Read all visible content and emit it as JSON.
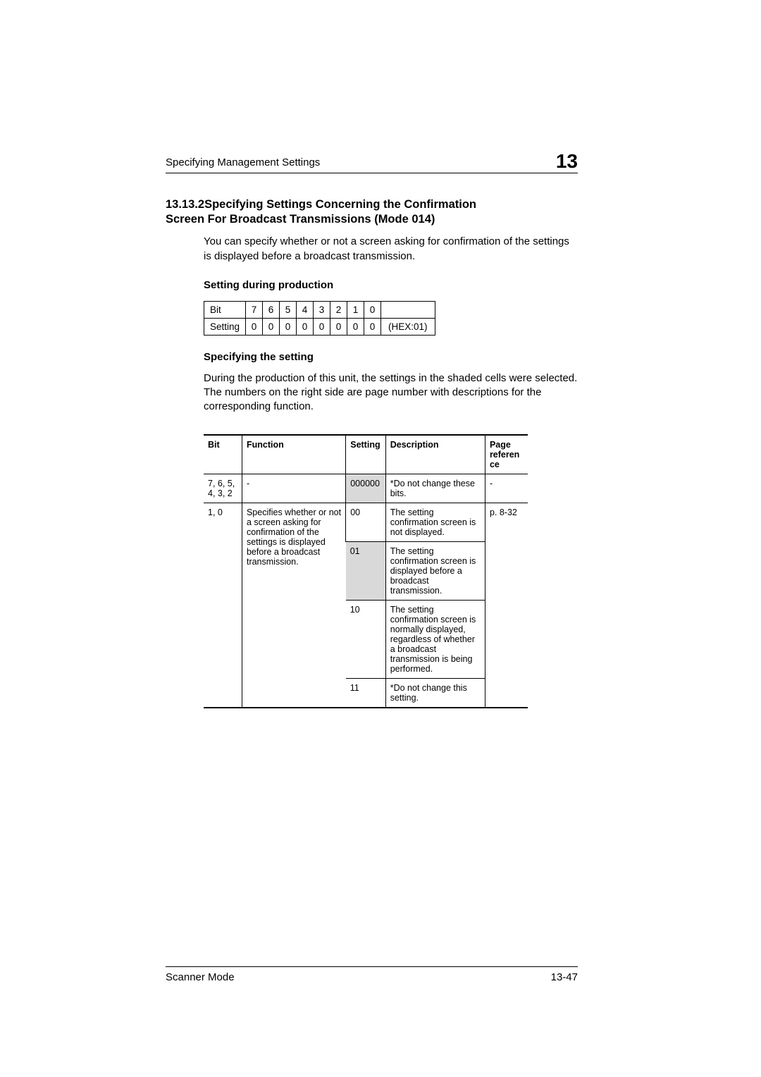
{
  "header": {
    "running_head": "Specifying Management Settings",
    "chapter_number": "13"
  },
  "section": {
    "number": "13.13.2",
    "title_line1": "Specifying Settings Concerning the Confirmation",
    "title_line2": "Screen For Broadcast Transmissions (Mode 014)"
  },
  "intro_text": "You can specify whether or not a screen asking for confirmation of the settings is displayed before a broadcast transmission.",
  "sub1": "Setting during production",
  "bit_table": {
    "rows": [
      {
        "label": "Bit",
        "c7": "7",
        "c6": "6",
        "c5": "5",
        "c4": "4",
        "c3": "3",
        "c2": "2",
        "c1": "1",
        "c0": "0",
        "hex": ""
      },
      {
        "label": "Setting",
        "c7": "0",
        "c6": "0",
        "c5": "0",
        "c4": "0",
        "c3": "0",
        "c2": "0",
        "c1": "0",
        "c0": "0",
        "hex": "(HEX:01)"
      }
    ]
  },
  "sub2": "Specifying the setting",
  "body2": "During the production of this unit, the settings in the shaded cells were selected. The numbers on the right side are page number with descriptions for the corresponding function.",
  "func_table": {
    "headers": {
      "bit": "Bit",
      "function": "Function",
      "setting": "Setting",
      "description": "Description",
      "page": "Page referen ce"
    },
    "row1": {
      "bit": "7, 6, 5, 4, 3, 2",
      "function": "-",
      "setting": "000000",
      "description": "*Do not change these bits.",
      "page": "-"
    },
    "group": {
      "bit": "1, 0",
      "function": "Specifies whether or not a screen asking for confirmation of the settings is displayed before a broadcast transmission.",
      "page": "p. 8-32",
      "rows": [
        {
          "setting": "00",
          "description": "The setting confirmation screen is not displayed."
        },
        {
          "setting": "01",
          "description": "The setting confirmation screen is displayed before a broadcast transmission."
        },
        {
          "setting": "10",
          "description": "The setting confirmation screen is normally displayed, regardless of whether a broadcast transmission is being performed."
        },
        {
          "setting": "11",
          "description": "*Do not change this setting."
        }
      ]
    }
  },
  "footer": {
    "left": "Scanner Mode",
    "right": "13-47"
  }
}
